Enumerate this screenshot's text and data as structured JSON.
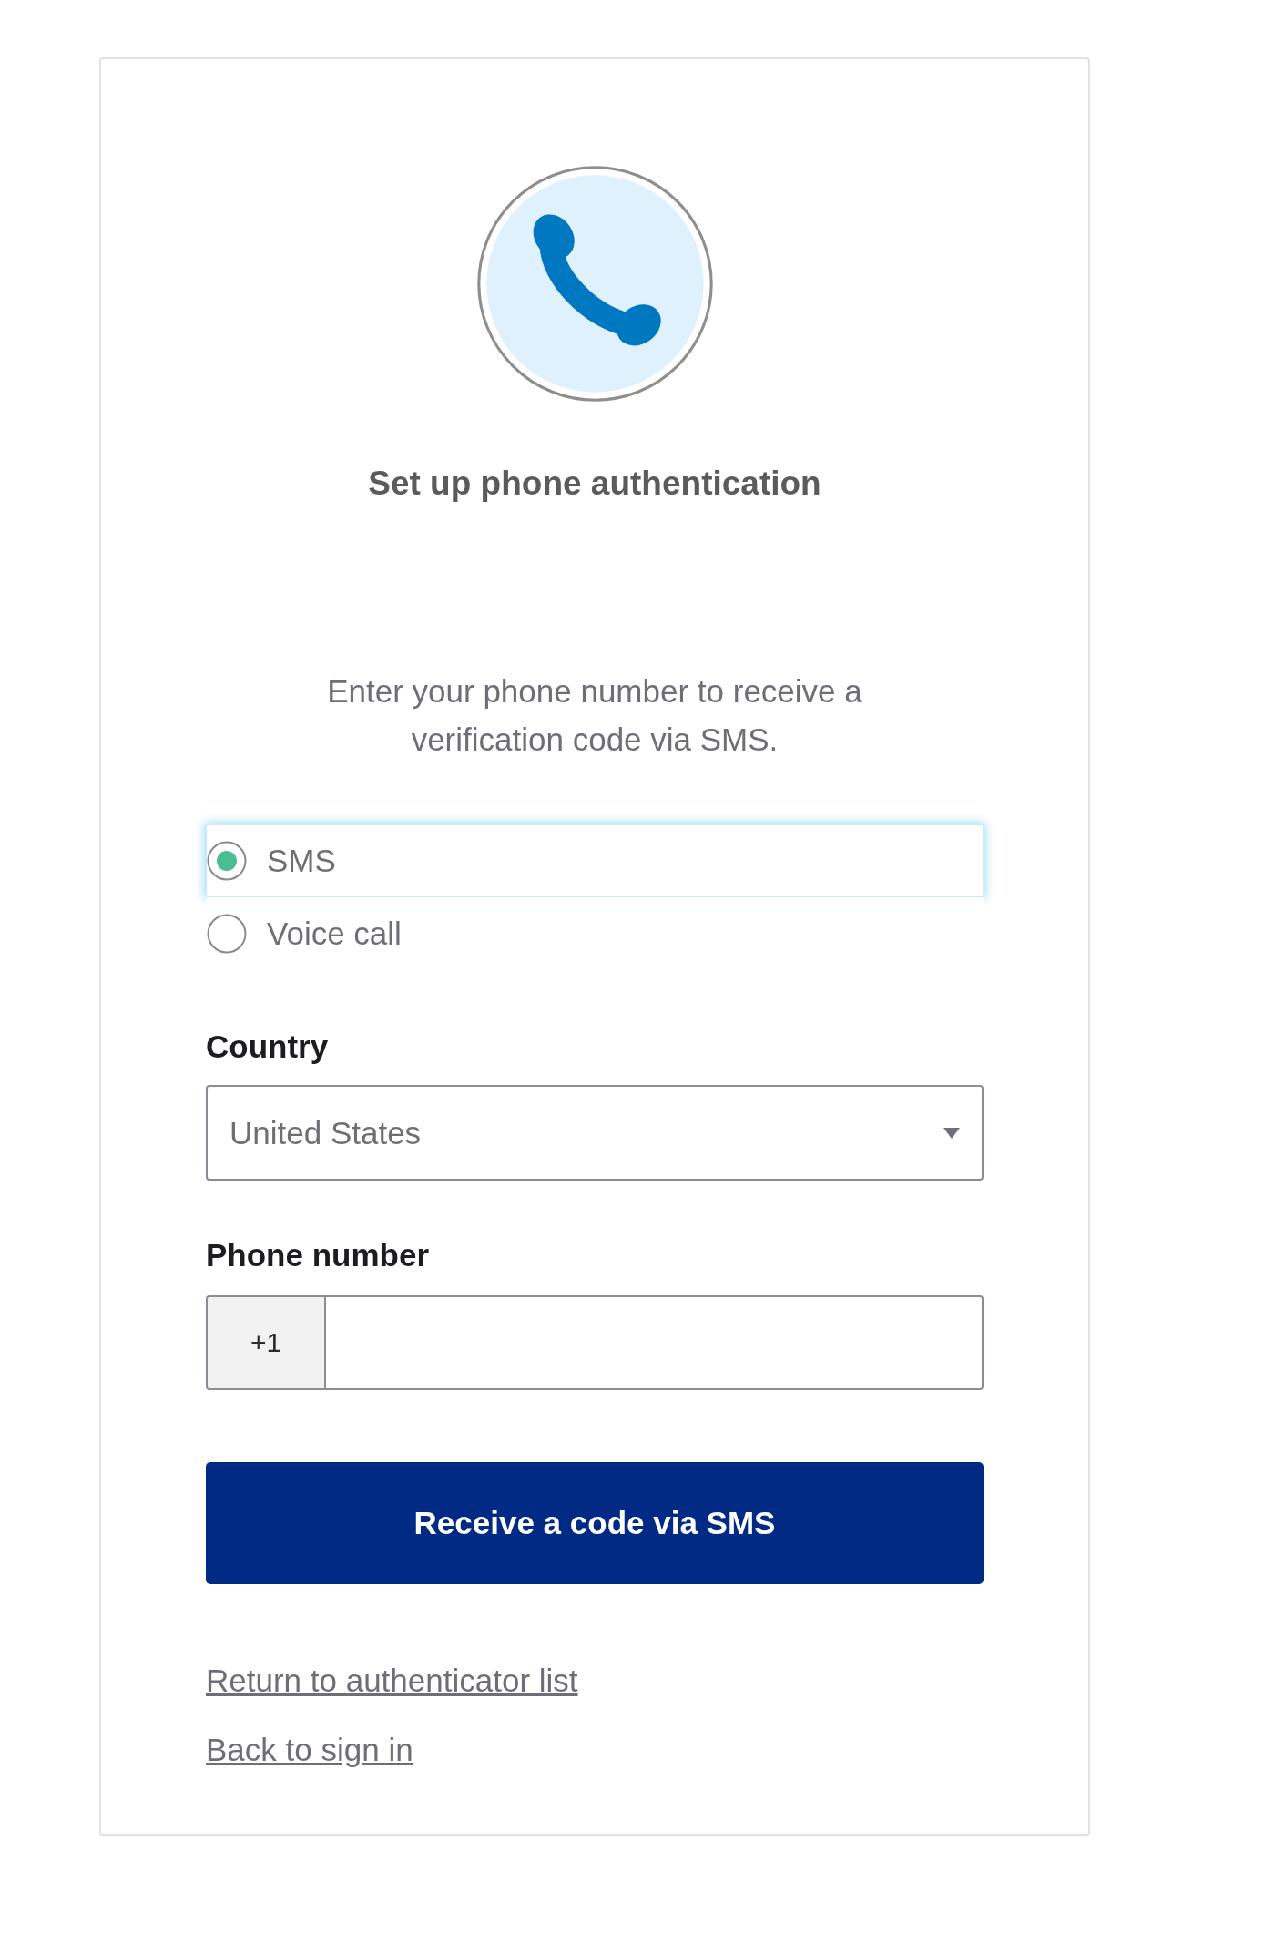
{
  "header": {
    "title": "Set up phone authentication"
  },
  "description": "Enter your phone number to receive a verification code via SMS.",
  "methods": [
    {
      "label": "SMS",
      "selected": true,
      "focused": true
    },
    {
      "label": "Voice call",
      "selected": false,
      "focused": false
    }
  ],
  "country": {
    "label": "Country",
    "value": "United States"
  },
  "phone": {
    "label": "Phone number",
    "prefix": "+1"
  },
  "submit_button": "Receive a code via SMS",
  "links": [
    "Return to authenticator list",
    "Back to sign in"
  ]
}
